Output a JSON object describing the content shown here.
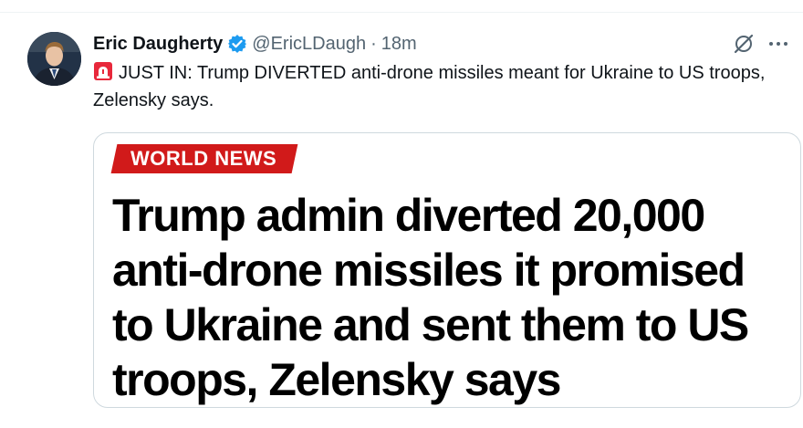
{
  "tweet": {
    "author": {
      "display_name": "Eric Daugherty",
      "handle": "@EricLDaugh",
      "verified": true
    },
    "separator": "·",
    "timestamp": "18m",
    "text": "JUST IN: Trump DIVERTED anti-drone missiles meant for Ukraine to US troops, Zelensky says.",
    "text_emoji": "siren-icon",
    "icons": {
      "grok": "grok-icon",
      "more": "more-icon"
    }
  },
  "card": {
    "tag": "WORLD NEWS",
    "headline": "Trump admin diverted 20,000 anti-drone missiles it promised to Ukraine and sent them to US troops, Zelensky says"
  },
  "colors": {
    "verified_blue": "#1d9bf0",
    "tag_red": "#d11a1a",
    "secondary_text": "#536471",
    "primary_text": "#0f1419"
  }
}
